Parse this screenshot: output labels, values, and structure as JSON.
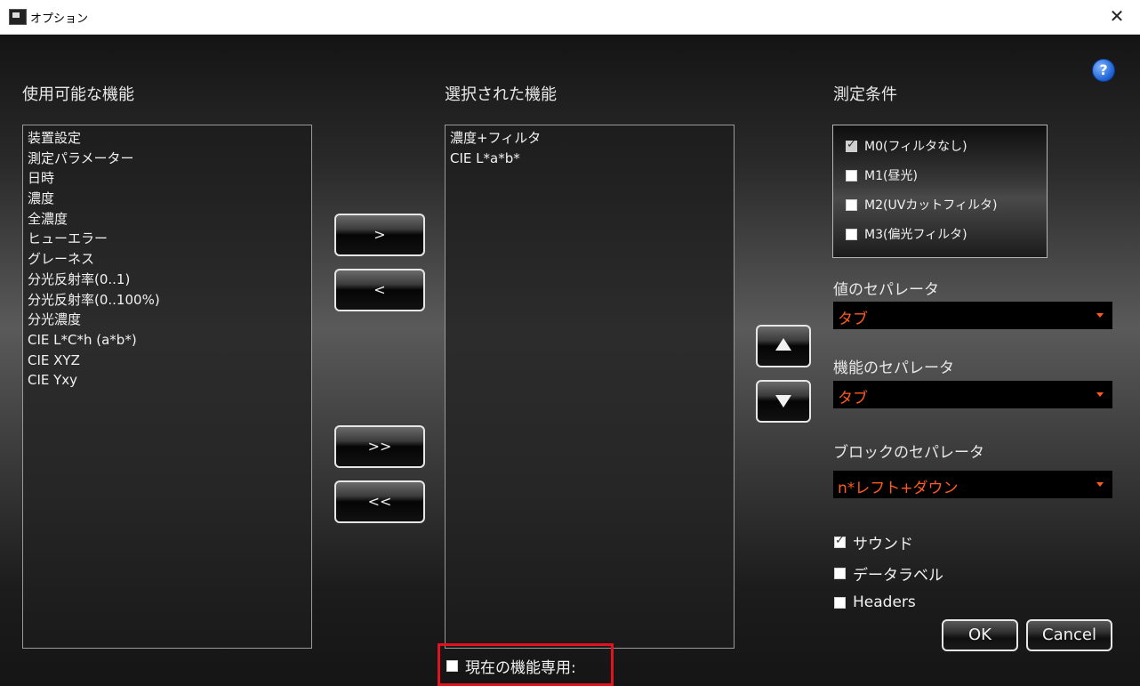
{
  "window": {
    "title": "オプション",
    "close_glyph": "✕"
  },
  "help": {
    "glyph": "?"
  },
  "available": {
    "heading": "使用可能な機能",
    "items": [
      "装置設定",
      "測定パラメーター",
      "日時",
      "濃度",
      "全濃度",
      "ヒューエラー",
      "グレーネス",
      "分光反射率(0..1)",
      "分光反射率(0..100%)",
      "分光濃度",
      "CIE L*C*h (a*b*)",
      "CIE XYZ",
      "CIE Yxy"
    ]
  },
  "selected": {
    "heading": "選択された機能",
    "items": [
      "濃度+フィルタ",
      "CIE L*a*b*"
    ]
  },
  "transfer_buttons": {
    "add": ">",
    "remove": "<",
    "add_all": ">>",
    "remove_all": "<<"
  },
  "conditions": {
    "heading": "測定条件",
    "items": [
      {
        "label": "M0(フィルタなし)",
        "checked": true,
        "disabled": true
      },
      {
        "label": "M1(昼光)",
        "checked": false
      },
      {
        "label": "M2(UVカットフィルタ)",
        "checked": false
      },
      {
        "label": "M3(偏光フィルタ)",
        "checked": false
      }
    ]
  },
  "value_separator": {
    "label": "値のセパレータ",
    "value": "タブ"
  },
  "feature_separator": {
    "label": "機能のセパレータ",
    "value": "タブ"
  },
  "block_separator": {
    "label": "ブロックのセパレータ",
    "value": "n*レフト+ダウン"
  },
  "options": {
    "sound": {
      "label": "サウンド",
      "checked": true
    },
    "data_label": {
      "label": "データラベル",
      "checked": false
    },
    "headers": {
      "label": "Headers",
      "checked": false
    }
  },
  "current_only": {
    "label": "現在の機能専用:",
    "checked": false
  },
  "dialog_buttons": {
    "ok": "OK",
    "cancel": "Cancel"
  },
  "colors": {
    "accent_orange": "#ff5a1f",
    "highlight_red": "#e0141e",
    "help_blue": "#1a5fd1"
  }
}
